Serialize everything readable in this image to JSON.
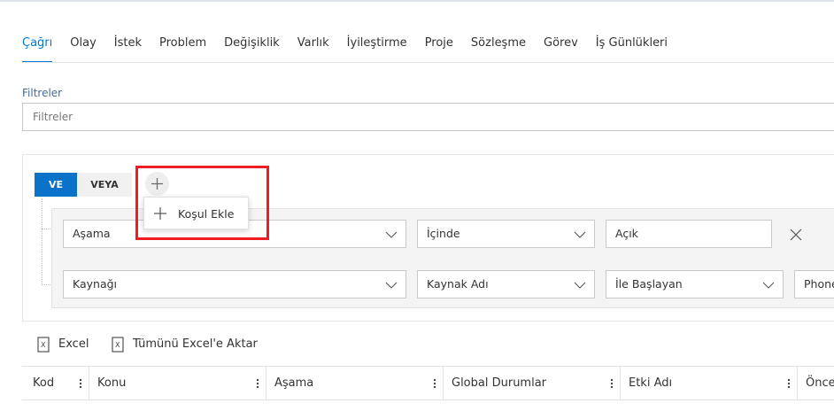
{
  "tabs": [
    "Çağrı",
    "Olay",
    "İstek",
    "Problem",
    "Değişiklik",
    "Varlık",
    "İyileştirme",
    "Proje",
    "Sözleşme",
    "Görev",
    "İş Günlükleri"
  ],
  "filters": {
    "label": "Filtreler",
    "placeholder": "Filtreler"
  },
  "logic": {
    "and_label": "VE",
    "or_label": "VEYA"
  },
  "add_menu": {
    "add_condition_label": "Koşul Ekle"
  },
  "conditions": [
    {
      "field": "Aşama",
      "operator": "İçinde",
      "value": "Açık"
    },
    {
      "field": "Kaynağı",
      "operator": "Kaynak Adı",
      "operator2": "İle Başlayan",
      "value": "Phone"
    }
  ],
  "toolbar": {
    "excel_label": "Excel",
    "export_all_label": "Tümünü Excel'e Aktar"
  },
  "grid": {
    "columns": [
      "Kod",
      "Konu",
      "Aşama",
      "Global Durumlar",
      "Etki Adı",
      "Önce"
    ]
  },
  "colors": {
    "accent": "#0078d4",
    "highlight": "#ee1c23"
  }
}
